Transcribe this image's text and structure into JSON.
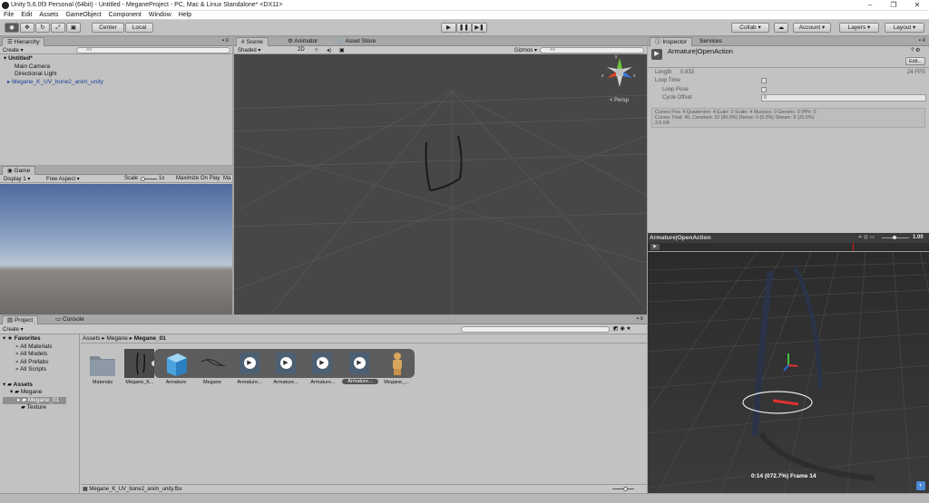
{
  "window": {
    "title": "Unity 5.6.0f3 Personal (64bit) - Untitled - MeganeProject - PC, Mac & Linux Standalone* <DX11>",
    "controls": [
      "–",
      "❐",
      "✕"
    ]
  },
  "menu": [
    "File",
    "Edit",
    "Assets",
    "GameObject",
    "Component",
    "Window",
    "Help"
  ],
  "toolbar": {
    "center": "Center",
    "local": "Local",
    "collab": "Collab ▾",
    "account": "Account",
    "layers": "Layers",
    "layout": "Layout"
  },
  "hierarchy": {
    "tab": "Hierarchy",
    "create": "Create ▾",
    "search": "All",
    "scene": "Untitled*",
    "items": [
      "Main Camera",
      "Directional Light",
      "Megane_K_UV_bone2_anim_unity"
    ]
  },
  "game": {
    "tab": "Game",
    "display": "Display 1",
    "aspect": "Free Aspect",
    "scale_label": "Scale",
    "scale_value": "1x",
    "maximize": "Maximize On Play",
    "ma": "Ma"
  },
  "scene": {
    "tabs": [
      "Scene",
      "Animator",
      "Asset Store"
    ],
    "shading": "Shaded",
    "mode2d": "2D",
    "gizmos": "Gizmos ▾",
    "search": "All",
    "persp": "< Persp",
    "axes": {
      "x": "x",
      "y": "y",
      "z": "z"
    }
  },
  "inspector": {
    "tabs": [
      "Inspector",
      "Services"
    ],
    "object_name": "Armature|OpenAction",
    "edit_btn": "Edit...",
    "length_label": "Length",
    "length_value": "0.833",
    "fps": "24 FPS",
    "loop_time": "Loop Time",
    "loop_pose": "Loop Pose",
    "cycle_offset": "Cycle Offset",
    "cycle_offset_value": "0",
    "stats_line1": "Curves Pos: 4 Quaternion: 4 Euler: 0 Scale: 4 Muscles: 0 Generic: 0 PPtr: 0",
    "stats_line2": "Curves Total: 40, Constant: 32 (80.0%) Dense: 0 (0.0%) Stream: 8 (20.0%)",
    "stats_line3": "3.6 KB"
  },
  "preview": {
    "title": "Armature|OpenAction",
    "speed": "1.00",
    "time_readout": "0:14 (072.7%) Frame 14"
  },
  "project": {
    "tabs": [
      "Project",
      "Console"
    ],
    "create": "Create ▾",
    "favorites": "Favorites",
    "fav_items": [
      "All Materials",
      "All Models",
      "All Prefabs",
      "All Scripts"
    ],
    "assets_root": "Assets",
    "folders": [
      "Megane",
      "Megane_01",
      "Texture"
    ],
    "breadcrumb": [
      "Assets",
      "Megane",
      "Megane_01"
    ],
    "assets": [
      "Materials",
      "Megane_K...",
      "Armature",
      "Megane",
      "Armature...",
      "Armature...",
      "Armature...",
      "Armature...",
      "Megane_..."
    ],
    "status_file": "Megane_K_UV_bone2_anim_unity.fbx"
  }
}
